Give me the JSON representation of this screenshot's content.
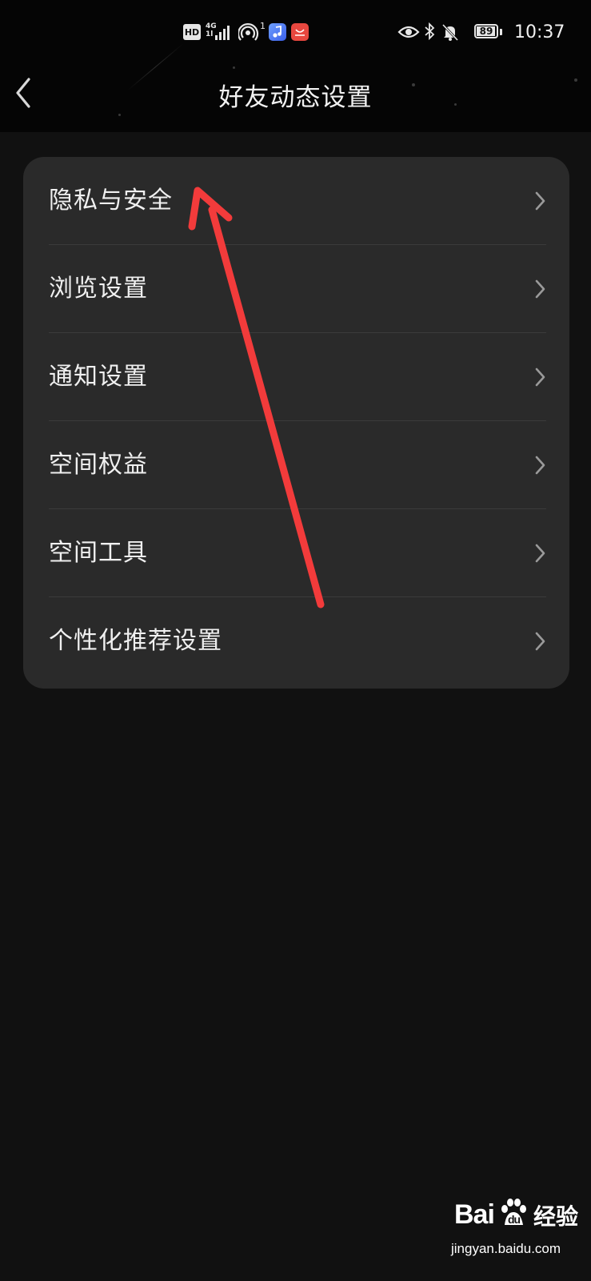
{
  "status_bar": {
    "hd": "HD",
    "network": "4G",
    "network_sub": "1l",
    "hotspot_count": "1",
    "battery": "89",
    "time": "10:37"
  },
  "nav": {
    "title": "好友动态设置",
    "back_icon": "chevron-left-icon"
  },
  "settings": {
    "items": [
      {
        "label": "隐私与安全"
      },
      {
        "label": "浏览设置"
      },
      {
        "label": "通知设置"
      },
      {
        "label": "空间权益"
      },
      {
        "label": "空间工具"
      },
      {
        "label": "个性化推荐设置"
      }
    ]
  },
  "watermark": {
    "brand": "Baidu",
    "brand_cn": "经验",
    "url": "jingyan.baidu.com"
  },
  "colors": {
    "background": "#111111",
    "header": "#050505",
    "card": "#2a2a2a",
    "text": "#f0f0f0",
    "chevron": "#9a9a9a",
    "annotation_arrow": "#f23b3b"
  }
}
